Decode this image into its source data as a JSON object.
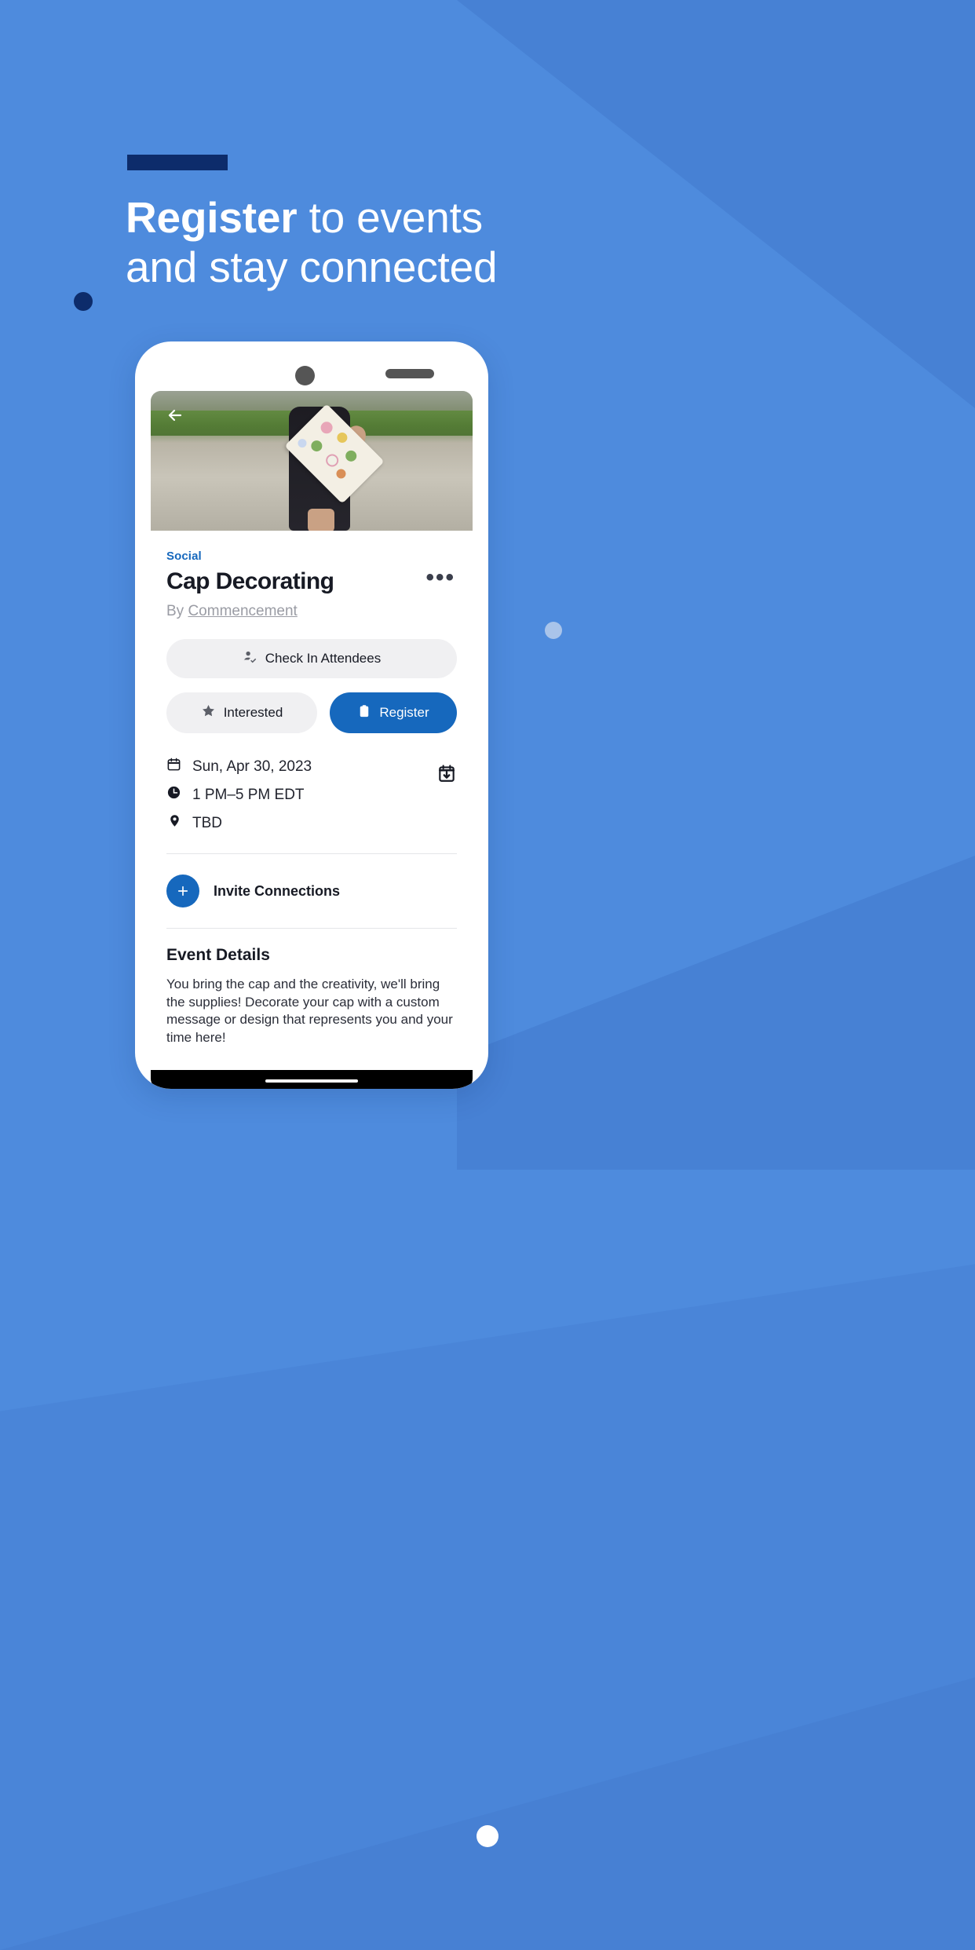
{
  "promo": {
    "headline_strong": "Register",
    "headline_rest": " to events",
    "headline_line2": "and stay connected",
    "accent_color": "#0d2c6b",
    "background_color": "#4e8bdd"
  },
  "phone": {
    "camera": "front-camera",
    "speaker": "earpiece-speaker"
  },
  "event": {
    "back_icon": "arrow-left-icon",
    "hero_image_alt": "graduate-holding-decorated-cap",
    "category": "Social",
    "title": "Cap Decorating",
    "more_menu": "•••",
    "by_prefix": "By ",
    "host": "Commencement",
    "actions": {
      "check_in": "Check In Attendees",
      "check_in_icon": "person-check-icon",
      "interested": "Interested",
      "interested_icon": "star-icon",
      "register": "Register",
      "register_icon": "clipboard-icon",
      "register_color": "#1668bd"
    },
    "meta": {
      "date": "Sun, Apr 30, 2023",
      "date_icon": "calendar-icon",
      "time": "1 PM–5 PM EDT",
      "time_icon": "clock-icon",
      "location": "TBD",
      "location_icon": "location-pin-icon",
      "add_to_calendar_icon": "calendar-download-icon"
    },
    "invite": {
      "label": "Invite Connections",
      "icon": "plus-icon"
    },
    "details": {
      "heading": "Event Details",
      "body": "You bring the cap and the creativity, we'll bring the supplies! Decorate your cap with a custom message or design that represents you and your time here!"
    }
  },
  "decor": {
    "dot_dark_color": "#0d2c6b",
    "dot_light_color": "#a9c4ea",
    "page_indicator_color": "#ffffff"
  }
}
